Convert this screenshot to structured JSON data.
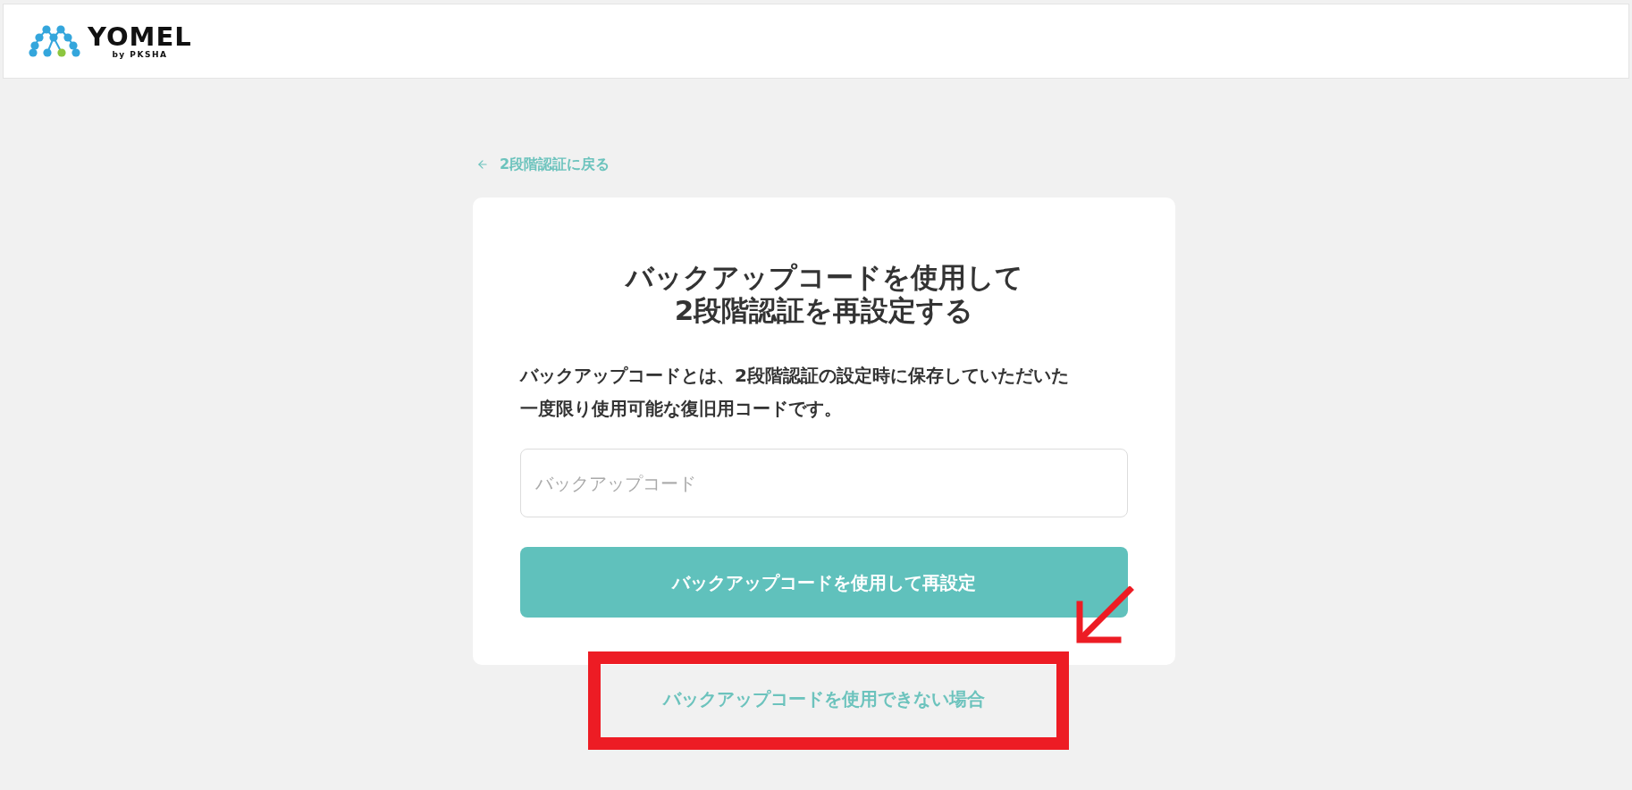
{
  "header": {
    "logo": {
      "name": "YOMEL",
      "byline": "by PKSHA"
    }
  },
  "back_link": {
    "label": "2段階認証に戻る"
  },
  "card": {
    "title": "バックアップコードを使用して2段階認証を再設定する",
    "description": "バックアップコードとは、2段階認証の設定時に保存していただいた一度限り使用可能な復旧用コードです。",
    "input": {
      "placeholder": "バックアップコード"
    },
    "submit_button": {
      "label": "バックアップコードを使用して再設定"
    }
  },
  "alt_link": {
    "label": "バックアップコードを使用できない場合"
  }
}
